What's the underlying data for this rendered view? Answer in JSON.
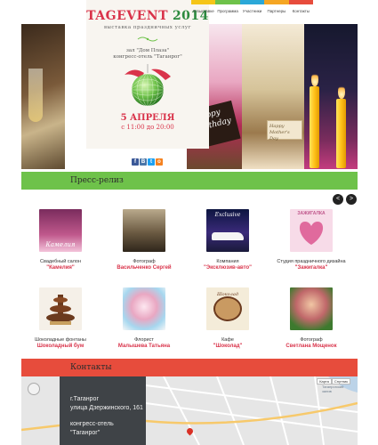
{
  "brand": {
    "name": "TAGEVENT",
    "year": "2014",
    "tagline": "выставка праздничных услуг"
  },
  "venue": {
    "line1": "зал \"Дом Плаза\"",
    "line2": "конгресс-отель \"Таганрог\""
  },
  "event": {
    "date": "5 АПРЕЛЯ",
    "time": "с 11:00 до 20:00"
  },
  "hero_cards": {
    "birthday": [
      "Happy",
      "Birthday"
    ],
    "mothers": [
      "Happy",
      "Mother's Day"
    ]
  },
  "social": [
    "f",
    "В",
    "t",
    "о"
  ],
  "nav": [
    {
      "label": "О выставке",
      "color": "#f5c518"
    },
    {
      "label": "Программа",
      "color": "#6ec24a"
    },
    {
      "label": "Участники",
      "color": "#2ba8d8"
    },
    {
      "label": "Партнеры",
      "color": "#f5a623"
    },
    {
      "label": "Контакты",
      "color": "#e74c3c"
    }
  ],
  "sections": {
    "press": "Пресс-релиз",
    "contacts": "Контакты"
  },
  "carousel": {
    "prev": "<",
    "next": ">"
  },
  "press_items": [
    {
      "caption": "Свадебный салон",
      "name": "\"Камелия\"",
      "thumb_text": "Камелия"
    },
    {
      "caption": "Фотограф",
      "name": "Васильченко Сергей",
      "thumb_text": ""
    },
    {
      "caption": "Компания",
      "name": "\"Эксклюзив-авто\"",
      "thumb_text": "Exclusive"
    },
    {
      "caption": "Студия праздничного дизайна",
      "name": "\"Зажигалка\"",
      "thumb_text": "ЗАЖИГАЛКА"
    },
    {
      "caption": "Шоколадные фонтаны",
      "name": "Шоколадный бум",
      "thumb_text": ""
    },
    {
      "caption": "Флорист",
      "name": "Малышева Татьяна",
      "thumb_text": ""
    },
    {
      "caption": "Кафе",
      "name": "\"Шоколад\"",
      "thumb_text": "Шоколад"
    },
    {
      "caption": "Фотограф",
      "name": "Светлана Мощенок",
      "thumb_text": ""
    }
  ],
  "contacts": {
    "address": [
      "г.Таганрог",
      "улица Дзержинского, 161"
    ],
    "hotel": [
      "конгресс-отель",
      "\"Таганрог\""
    ]
  },
  "map": {
    "type_options": [
      "Карта",
      "Спутник"
    ],
    "label": "Таганрогский залив"
  },
  "colors": {
    "red": "#d9334a",
    "green": "#6ec24a",
    "bar_red": "#e74c3c",
    "panel_dark": "#3f4347"
  }
}
